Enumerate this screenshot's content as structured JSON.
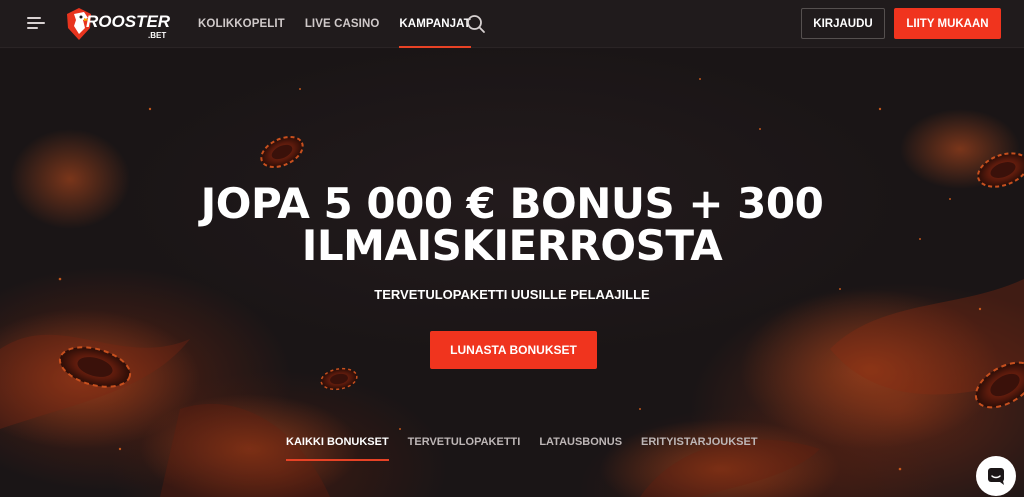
{
  "header": {
    "logo_text": "ROOSTER",
    "logo_subtext": ".BET",
    "nav": [
      {
        "label": "KOLIKKOPELIT",
        "active": false
      },
      {
        "label": "LIVE CASINO",
        "active": false
      },
      {
        "label": "KAMPANJAT",
        "active": true
      }
    ],
    "login_label": "KIRJAUDU",
    "join_label": "LIITY MUKAAN",
    "icons": [
      "menu-icon",
      "search-icon"
    ]
  },
  "hero": {
    "title_line1": "JOPA 5 000 € BONUS + 300",
    "title_line2": "ILMAISKIERROSTA",
    "subtitle": "TERVETULOPAKETTI UUSILLE PELAAJILLE",
    "cta_label": "LUNASTA BONUKSET"
  },
  "tabs": [
    {
      "label": "KAIKKI BONUKSET",
      "active": true
    },
    {
      "label": "TERVETULOPAKETTI",
      "active": false
    },
    {
      "label": "LATAUSBONUS",
      "active": false
    },
    {
      "label": "ERITYISTARJOUKSET",
      "active": false
    }
  ],
  "chat": {
    "icon": "chat-icon"
  },
  "colors": {
    "accent": "#f0341e",
    "header_bg": "#201b1c",
    "hero_bg": "#1a1516"
  }
}
